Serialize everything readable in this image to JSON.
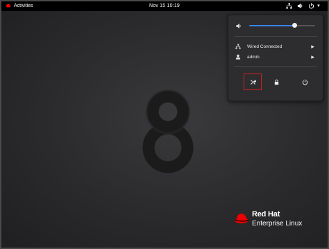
{
  "topbar": {
    "activities_label": "Activities",
    "clock": "Nov 15  10:19",
    "tray_icons": [
      "network-icon",
      "volume-icon",
      "power-icon"
    ]
  },
  "desktop": {
    "logo": {
      "line1": "Red Hat",
      "line2": "Enterprise Linux"
    }
  },
  "system_menu": {
    "volume_percent": 68,
    "items": [
      {
        "icon": "network-icon",
        "label": "Wired Connected"
      },
      {
        "icon": "user-icon",
        "label": "admin"
      }
    ],
    "buttons": [
      "settings-icon",
      "lock-icon",
      "power-off-icon"
    ],
    "accent": "#3b84f0",
    "highlight": "#d21f1f"
  }
}
